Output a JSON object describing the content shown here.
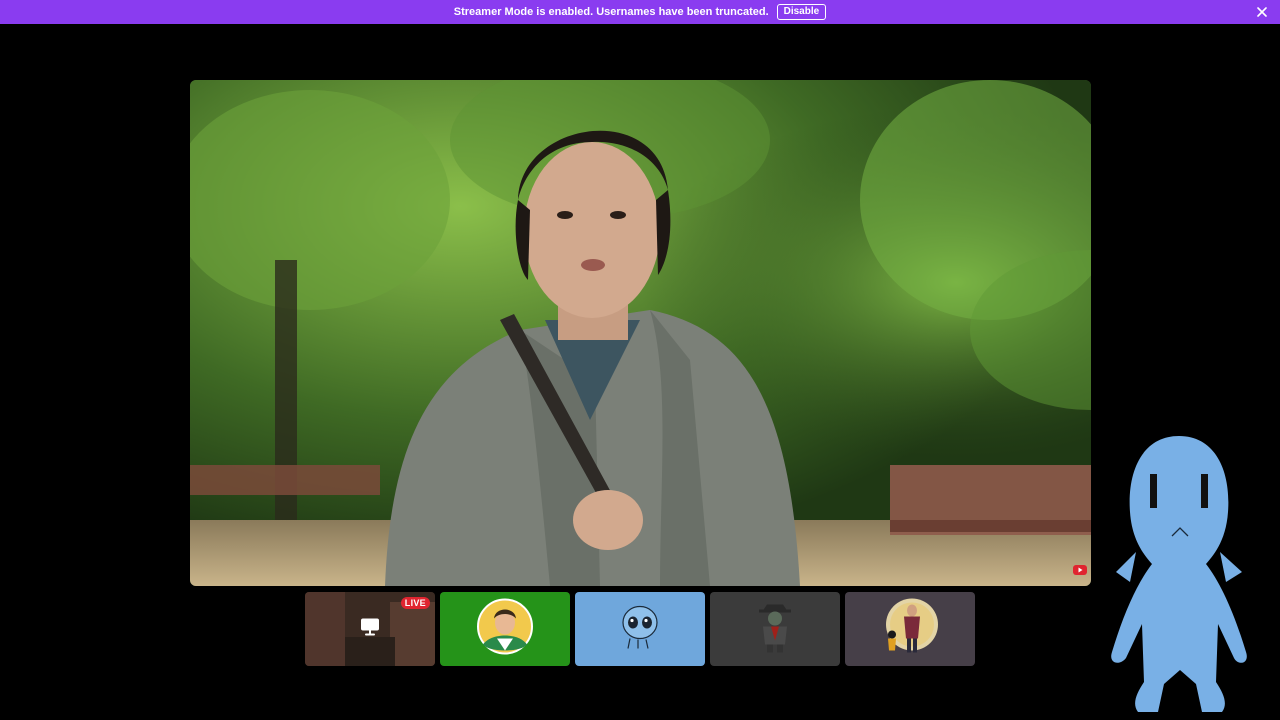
{
  "banner": {
    "message": "Streamer Mode is enabled. Usernames have been truncated.",
    "disable_label": "Disable",
    "icon": "close-icon",
    "color": "#8a3cf0"
  },
  "stage": {
    "icon": "youtube-icon"
  },
  "participants": [
    {
      "kind": "stream",
      "badge": "LIVE",
      "icon": "screen-share-icon"
    },
    {
      "kind": "avatar",
      "icon": "avatar-anime-character-icon",
      "color": "#259319"
    },
    {
      "kind": "avatar",
      "icon": "avatar-blue-creature-icon",
      "color": "#6fa7dc"
    },
    {
      "kind": "avatar",
      "icon": "avatar-villain-character-icon",
      "color": "#3b3b3b"
    },
    {
      "kind": "avatar",
      "icon": "avatar-hero-character-icon",
      "color": "#463f48"
    }
  ],
  "overlay": {
    "icon": "blue-alien-mascot-icon"
  }
}
